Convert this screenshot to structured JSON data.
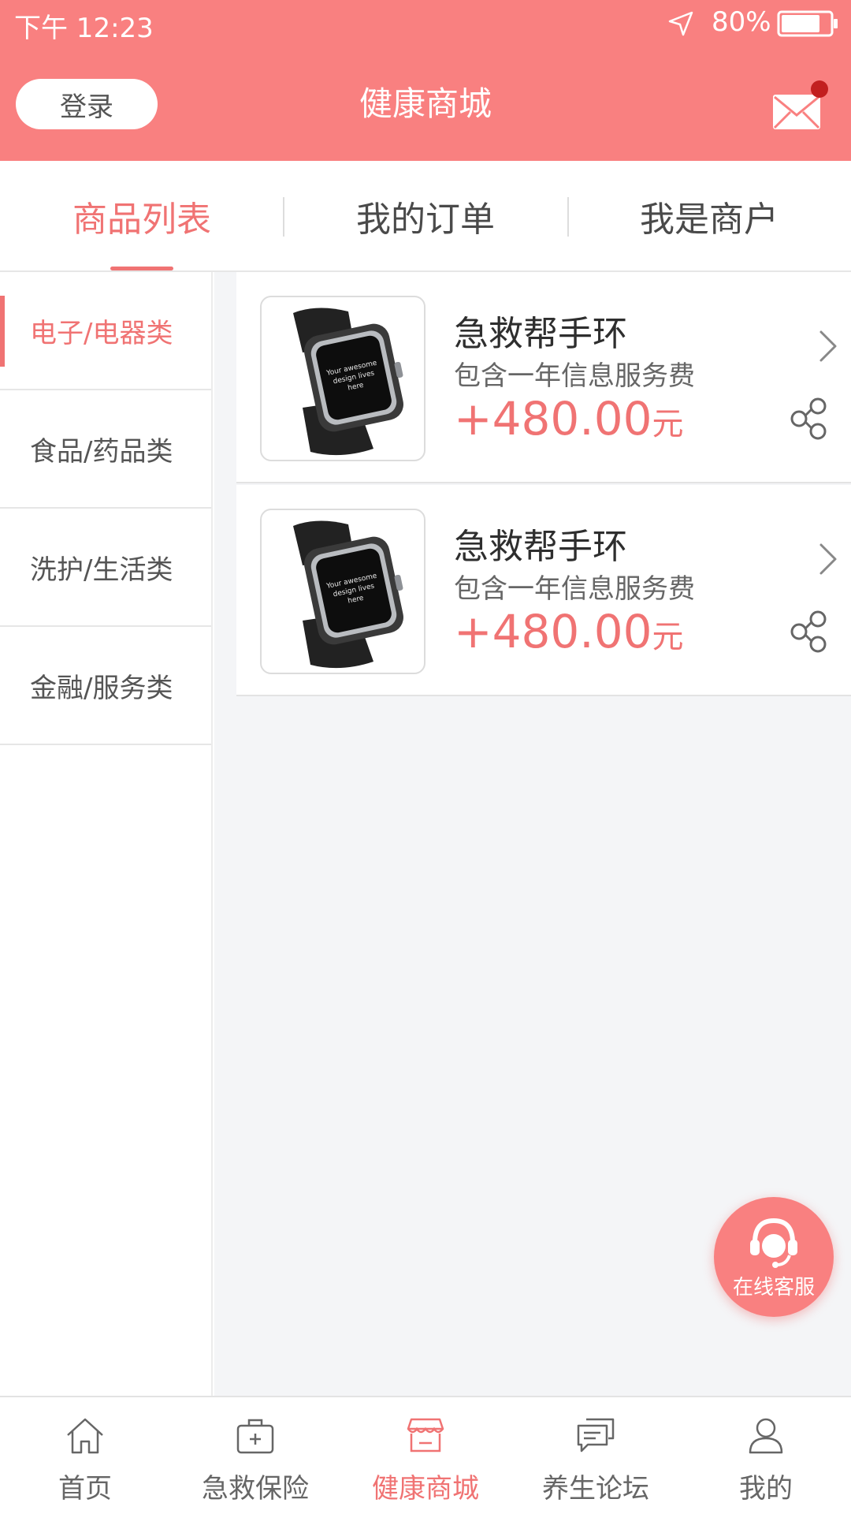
{
  "status_bar": {
    "time": "下午 12:23",
    "battery_percent": "80%",
    "battery_level": 0.8
  },
  "header": {
    "login_label": "登录",
    "title": "健康商城",
    "has_unread_mail": true
  },
  "tabs": [
    {
      "label": "商品列表",
      "active": true
    },
    {
      "label": "我的订单",
      "active": false
    },
    {
      "label": "我是商户",
      "active": false
    }
  ],
  "categories": [
    {
      "label": "电子/电器类",
      "active": true
    },
    {
      "label": "食品/药品类",
      "active": false
    },
    {
      "label": "洗护/生活类",
      "active": false
    },
    {
      "label": "金融/服务类",
      "active": false
    }
  ],
  "products": [
    {
      "name": "急救帮手环",
      "description": "包含一年信息服务费",
      "price": "+480.00",
      "price_unit": "元",
      "thumb_text": [
        "Your awesome",
        "design lives",
        "here"
      ]
    },
    {
      "name": "急救帮手环",
      "description": "包含一年信息服务费",
      "price": "+480.00",
      "price_unit": "元",
      "thumb_text": [
        "Your awesome",
        "design lives",
        "here"
      ]
    }
  ],
  "service_button": {
    "label": "在线客服"
  },
  "bottom_nav": [
    {
      "label": "首页",
      "icon": "home-icon",
      "active": false
    },
    {
      "label": "急救保险",
      "icon": "first-aid-kit-icon",
      "active": false
    },
    {
      "label": "健康商城",
      "icon": "store-icon",
      "active": true
    },
    {
      "label": "养生论坛",
      "icon": "chat-icon",
      "active": false
    },
    {
      "label": "我的",
      "icon": "user-icon",
      "active": false
    }
  ],
  "colors": {
    "brand": "#f98080",
    "accent": "#f07373",
    "notification": "#c21f1f"
  }
}
